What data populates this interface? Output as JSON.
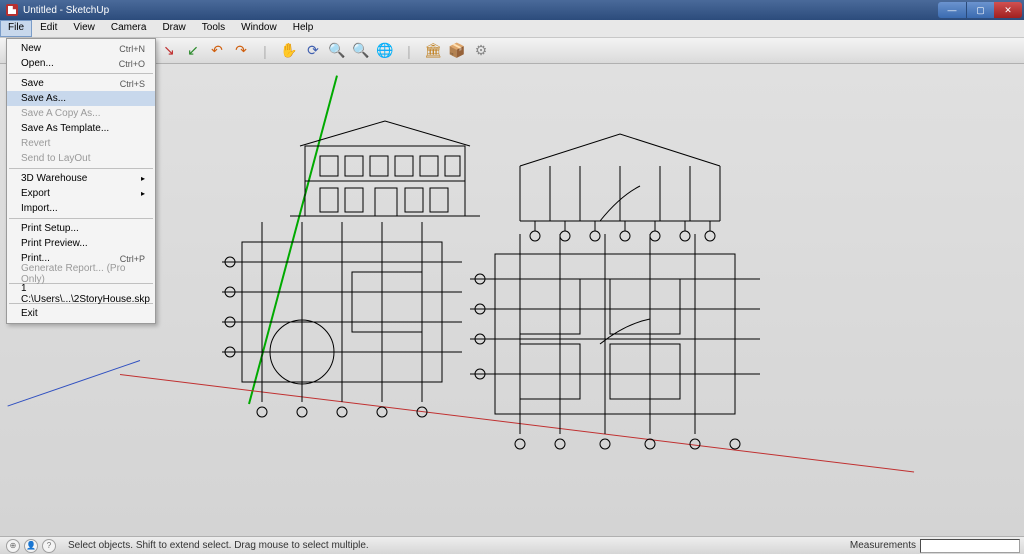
{
  "window": {
    "title": "Untitled - SketchUp"
  },
  "menubar": [
    "File",
    "Edit",
    "View",
    "Camera",
    "Draw",
    "Tools",
    "Window",
    "Help"
  ],
  "toolbar_icons": [
    {
      "name": "red-arrow",
      "glyph": "↘",
      "color": "#c03030"
    },
    {
      "name": "green-arrow",
      "glyph": "↙",
      "color": "#2a8a2a"
    },
    {
      "name": "orange-undo",
      "glyph": "↶",
      "color": "#d06010"
    },
    {
      "name": "orange-redo",
      "glyph": "↷",
      "color": "#d06010"
    },
    {
      "name": "sep",
      "glyph": "|",
      "color": "#b0b0b0"
    },
    {
      "name": "hand",
      "glyph": "✋",
      "color": "#4060b0"
    },
    {
      "name": "orbit",
      "glyph": "⟳",
      "color": "#4060b0"
    },
    {
      "name": "zoom",
      "glyph": "🔍",
      "color": "#4060b0"
    },
    {
      "name": "zoom-extents",
      "glyph": "🔍",
      "color": "#4060b0"
    },
    {
      "name": "earth",
      "glyph": "🌐",
      "color": "#2070b0"
    },
    {
      "name": "sep2",
      "glyph": "|",
      "color": "#b0b0b0"
    },
    {
      "name": "warehouse",
      "glyph": "🏛",
      "color": "#c08020"
    },
    {
      "name": "components",
      "glyph": "📦",
      "color": "#c08020"
    },
    {
      "name": "extension",
      "glyph": "⚙",
      "color": "#888"
    }
  ],
  "file_menu": [
    {
      "label": "New",
      "shortcut": "Ctrl+N",
      "enabled": true
    },
    {
      "label": "Open...",
      "shortcut": "Ctrl+O",
      "enabled": true
    },
    {
      "sep": true
    },
    {
      "label": "Save",
      "shortcut": "Ctrl+S",
      "enabled": true
    },
    {
      "label": "Save As...",
      "shortcut": "",
      "enabled": true,
      "hover": true
    },
    {
      "label": "Save A Copy As...",
      "shortcut": "",
      "enabled": false
    },
    {
      "label": "Save As Template...",
      "shortcut": "",
      "enabled": true
    },
    {
      "label": "Revert",
      "shortcut": "",
      "enabled": false
    },
    {
      "label": "Send to LayOut",
      "shortcut": "",
      "enabled": false
    },
    {
      "sep": true
    },
    {
      "label": "3D Warehouse",
      "submenu": true,
      "enabled": true
    },
    {
      "label": "Export",
      "submenu": true,
      "enabled": true
    },
    {
      "label": "Import...",
      "shortcut": "",
      "enabled": true
    },
    {
      "sep": true
    },
    {
      "label": "Print Setup...",
      "shortcut": "",
      "enabled": true
    },
    {
      "label": "Print Preview...",
      "shortcut": "",
      "enabled": true
    },
    {
      "label": "Print...",
      "shortcut": "Ctrl+P",
      "enabled": true
    },
    {
      "label": "Generate Report... (Pro Only)",
      "shortcut": "",
      "enabled": false
    },
    {
      "sep": true
    },
    {
      "label": "1 C:\\Users\\...\\2StoryHouse.skp",
      "shortcut": "",
      "enabled": true
    },
    {
      "sep": true
    },
    {
      "label": "Exit",
      "shortcut": "",
      "enabled": true
    }
  ],
  "status": {
    "hint": "Select objects. Shift to extend select. Drag mouse to select multiple.",
    "measurements_label": "Measurements"
  }
}
